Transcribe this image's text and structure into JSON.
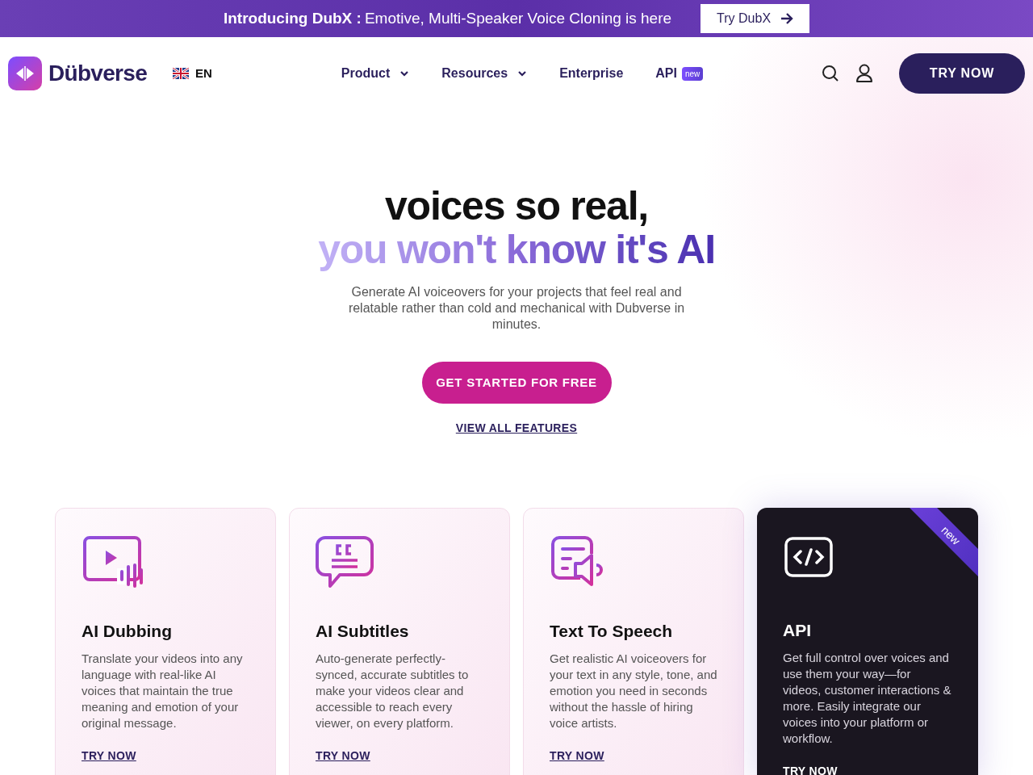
{
  "announcement": {
    "lead": "Introducing DubX :",
    "text": "Emotive, Multi-Speaker Voice Cloning is here",
    "button": "Try DubX"
  },
  "header": {
    "logo": "Dübverse",
    "language": "EN",
    "nav": [
      {
        "label": "Product",
        "has_menu": true
      },
      {
        "label": "Resources",
        "has_menu": true
      },
      {
        "label": "Enterprise",
        "has_menu": false
      },
      {
        "label": "API",
        "has_menu": false,
        "badge": "new"
      }
    ],
    "cta": "TRY NOW"
  },
  "hero": {
    "line_1": "voices so real,",
    "line_2": "you won't know it's AI",
    "subtitle": "Generate AI voiceovers for your projects that feel real and relatable rather than cold and mechanical with Dubverse in minutes.",
    "primary_button": "GET STARTED FOR FREE",
    "secondary_link": "VIEW ALL FEATURES"
  },
  "cards": [
    {
      "kind": "light",
      "title": "AI Dubbing",
      "text": "Translate your videos into any language with real-like AI voices that maintain the true meaning and emotion of your original message.",
      "link": "TRY NOW"
    },
    {
      "kind": "light",
      "title": "AI Subtitles",
      "text": "Auto-generate perfectly-synced, accurate subtitles to make your videos clear and accessible to reach every viewer, on every platform.",
      "link": "TRY NOW"
    },
    {
      "kind": "light",
      "title": "Text To Speech",
      "text": "Get realistic AI voiceovers for your text in any style, tone, and emotion you need in seconds without the hassle of hiring voice artists.",
      "link": "TRY NOW"
    },
    {
      "kind": "dark",
      "title": "API",
      "text": "Get full control over voices and use them your way—for videos, customer interactions & more. Easily integrate our voices into your platform or workflow.",
      "link": "TRY NOW",
      "badge": "new"
    }
  ]
}
